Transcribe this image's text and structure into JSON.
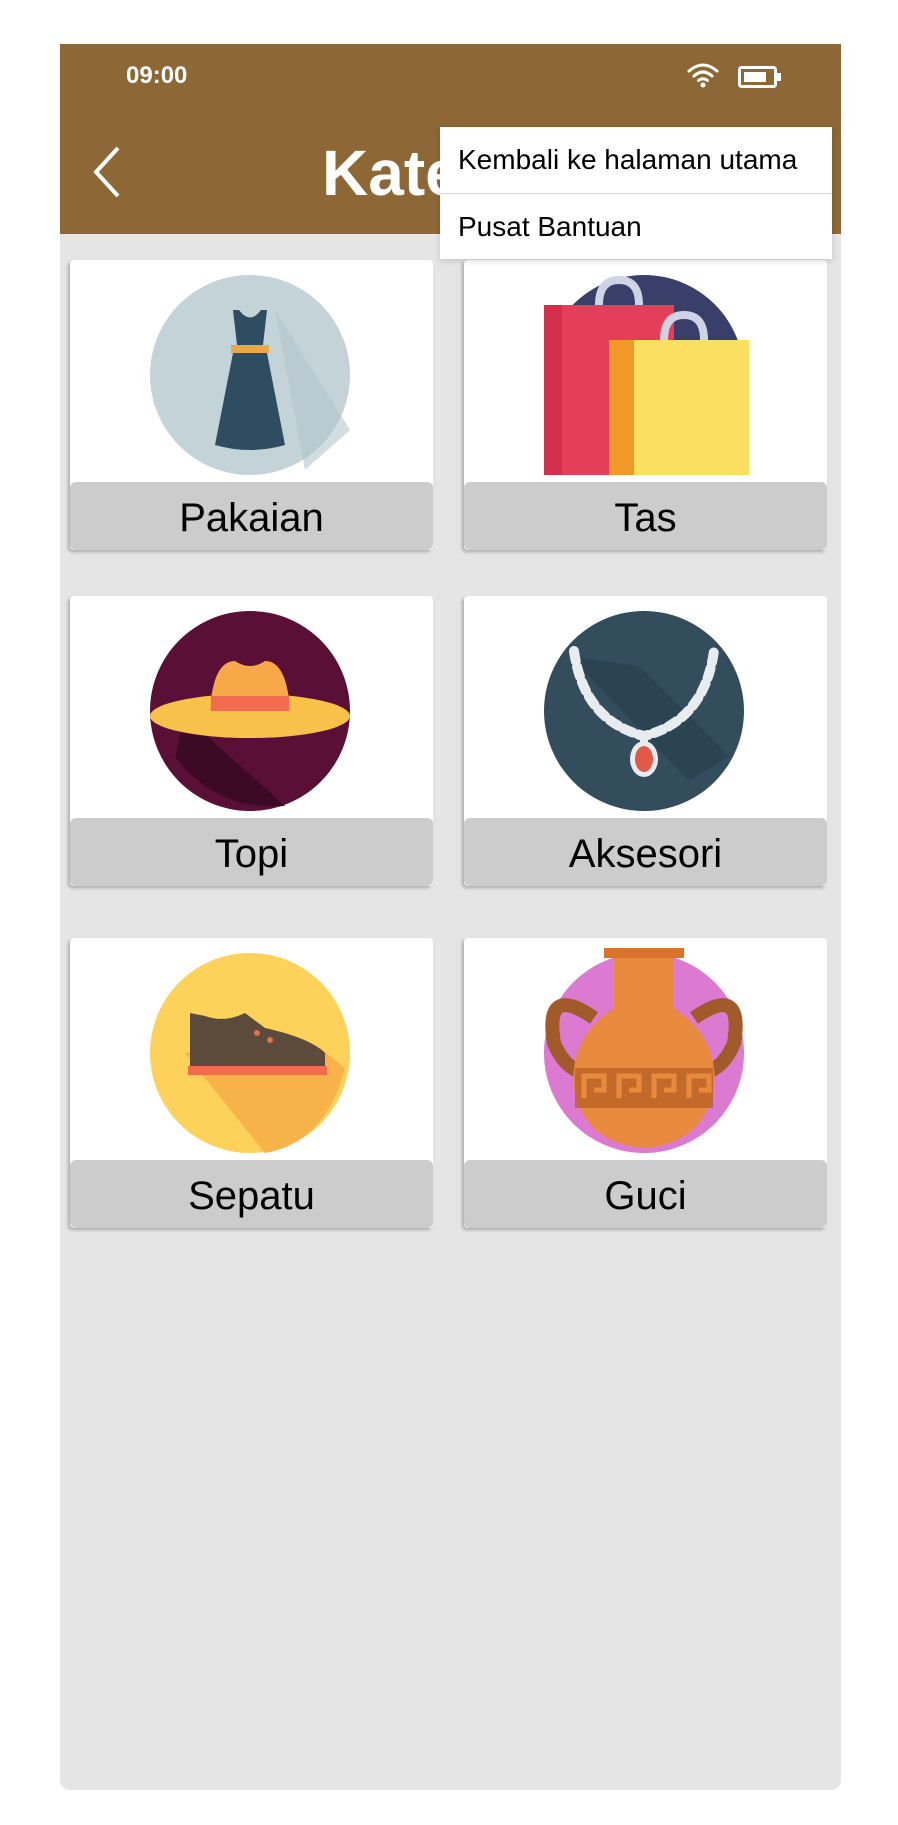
{
  "status_bar": {
    "time": "09:00"
  },
  "header": {
    "title": "Kategori"
  },
  "menu": {
    "items": [
      {
        "label": "Kembali ke halaman utama"
      },
      {
        "label": "Pusat Bantuan"
      }
    ]
  },
  "categories": [
    {
      "label": "Pakaian",
      "icon": "dress-icon"
    },
    {
      "label": "Tas",
      "icon": "shopping-bags-icon"
    },
    {
      "label": "Topi",
      "icon": "hat-icon"
    },
    {
      "label": "Aksesori",
      "icon": "necklace-icon"
    },
    {
      "label": "Sepatu",
      "icon": "shoe-icon"
    },
    {
      "label": "Guci",
      "icon": "vase-icon"
    }
  ],
  "colors": {
    "app_bar": "#8d6735",
    "background": "#e5e5e5",
    "label_bg": "#cccccc"
  }
}
